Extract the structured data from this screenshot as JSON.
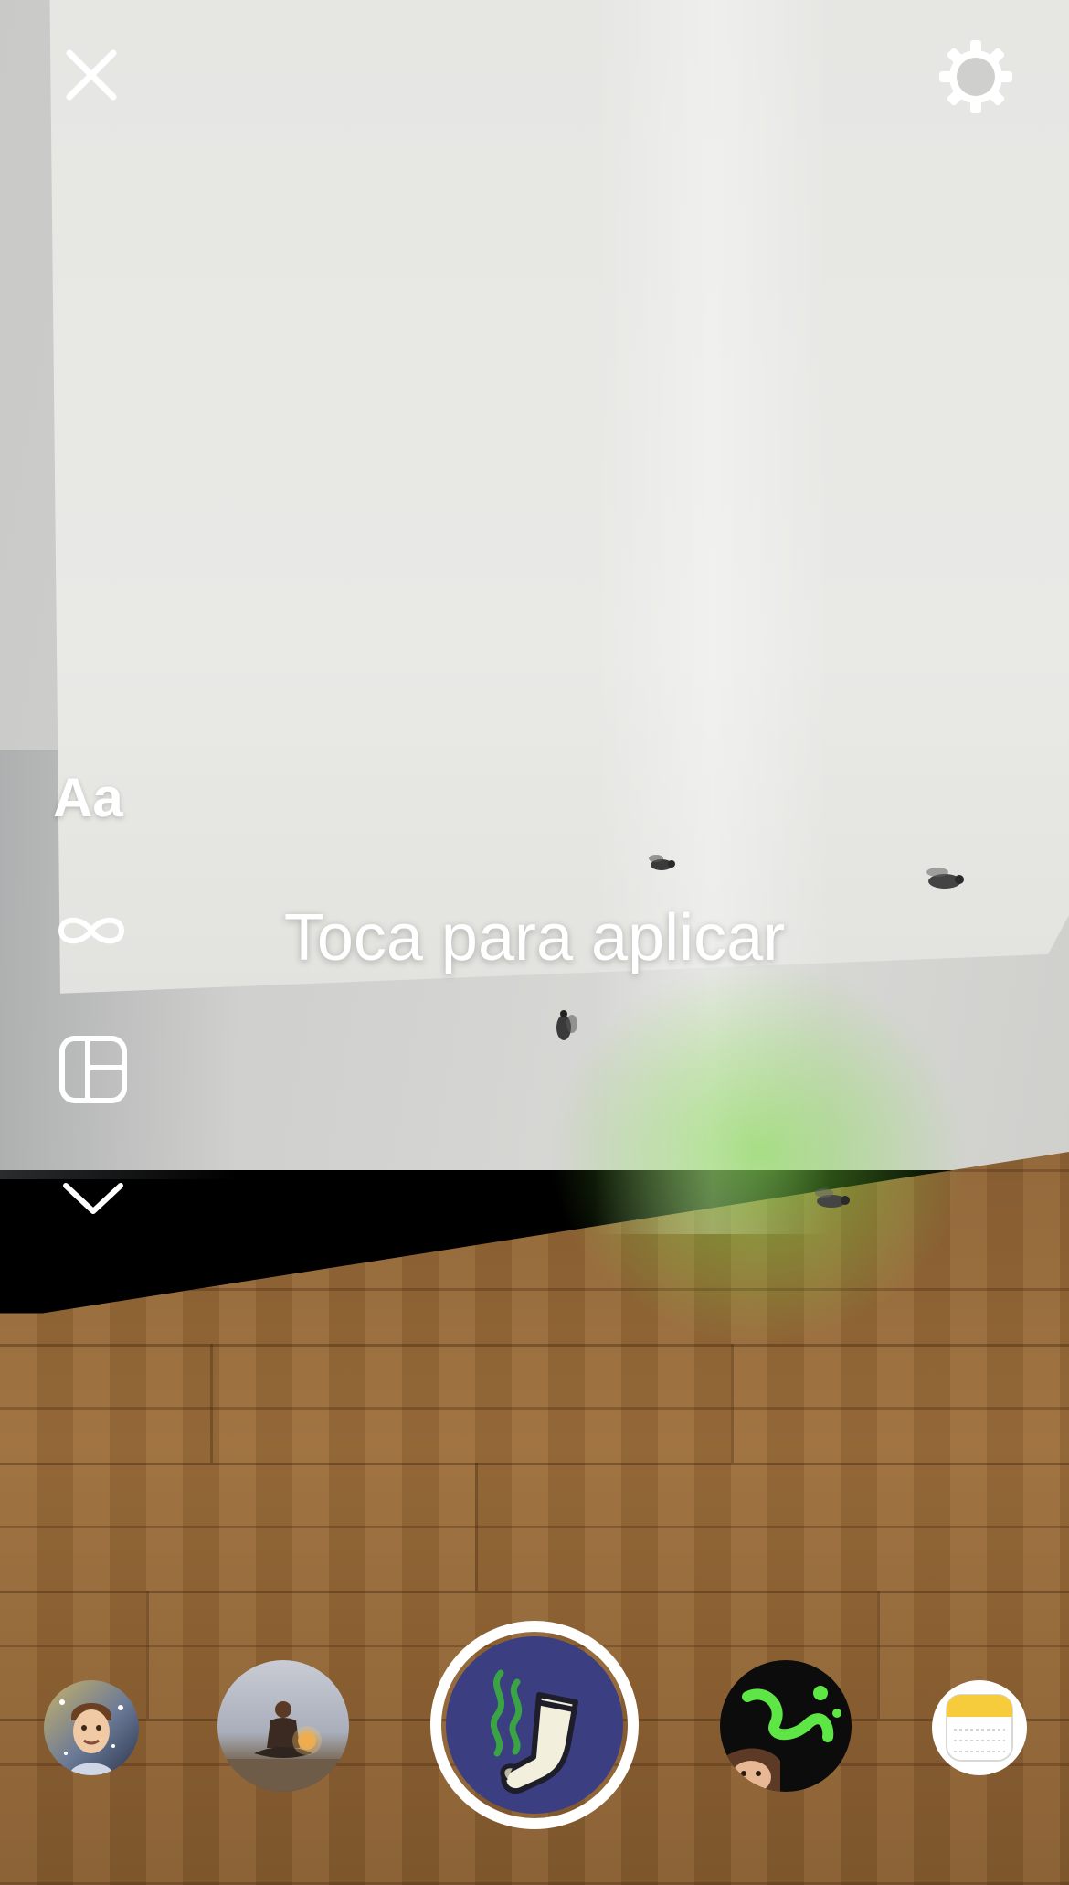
{
  "camera": {
    "hint_text": "Toca para aplicar",
    "text_tool_label": "Aa"
  },
  "top_bar": {
    "close_icon": "close-icon",
    "settings_icon": "settings-gear-icon"
  },
  "side_tools": [
    {
      "name": "text-mode",
      "icon": "text-aa-icon"
    },
    {
      "name": "boomerang",
      "icon": "infinity-icon"
    },
    {
      "name": "layout",
      "icon": "layout-grid-icon"
    },
    {
      "name": "more",
      "icon": "chevron-down-icon"
    }
  ],
  "effects_tray": {
    "items": [
      {
        "name": "memoji-effect",
        "icon": "memoji-thumbnail"
      },
      {
        "name": "meditation-effect",
        "icon": "meditation-thumbnail"
      },
      {
        "name": "smelly-sock-effect",
        "icon": "sock-icon",
        "selected": true
      },
      {
        "name": "green-slime-effect",
        "icon": "slime-thumbnail"
      },
      {
        "name": "notes-effect",
        "icon": "notes-icon"
      }
    ]
  },
  "colors": {
    "overlay_text": "#ffffff",
    "shutter_ring": "#ffffff",
    "selected_effect_bg": "#3c3e82"
  }
}
